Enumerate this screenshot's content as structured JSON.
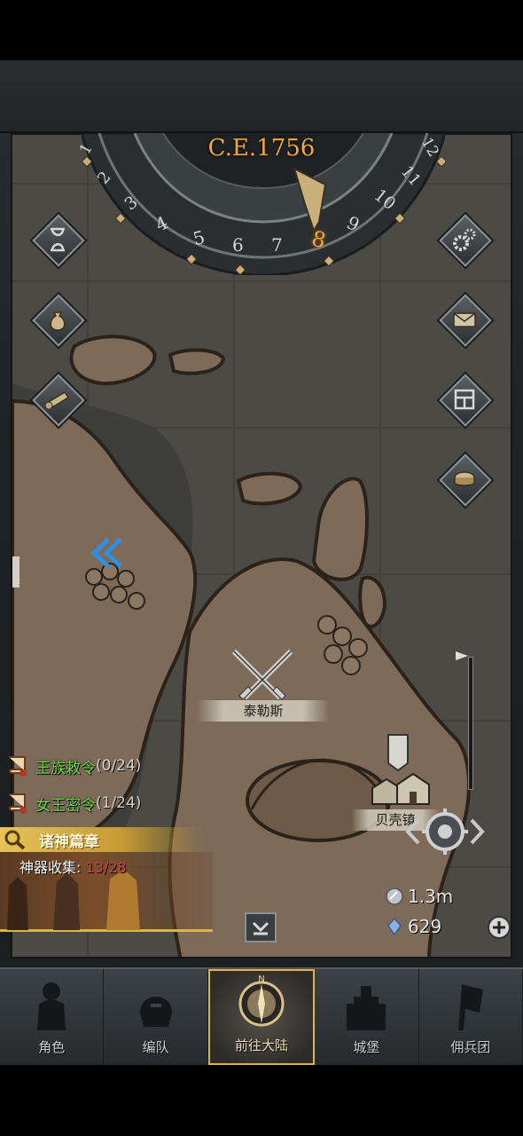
{
  "calendar": {
    "year_label": "C.E.1756",
    "months": [
      "1",
      "2",
      "3",
      "4",
      "5",
      "6",
      "7",
      "8",
      "9",
      "10",
      "11",
      "12"
    ],
    "current_month": "8"
  },
  "left_buttons": [
    {
      "icon": "hourglass-icon"
    },
    {
      "icon": "money-bag-icon"
    },
    {
      "icon": "scroll-icon"
    }
  ],
  "right_buttons": [
    {
      "icon": "gear-icon"
    },
    {
      "icon": "mail-icon"
    },
    {
      "icon": "window-grid-icon"
    },
    {
      "icon": "drum-icon"
    }
  ],
  "map": {
    "locations": [
      {
        "name": "泰勒斯"
      },
      {
        "name": "贝壳镇"
      }
    ]
  },
  "quests": [
    {
      "name": "王族敕令",
      "progress": "(0/24)"
    },
    {
      "name": "女王密令",
      "progress": "(1/24)"
    }
  ],
  "gods_chapter": {
    "title": "诸神篇章",
    "collect_label": "神器收集: ",
    "collect_value": "13/28"
  },
  "resources": {
    "silver": "1.3m",
    "crystal": "629"
  },
  "nav": [
    {
      "label": "角色",
      "icon": "knight-icon",
      "active": false
    },
    {
      "label": "编队",
      "icon": "helmet-icon",
      "active": false
    },
    {
      "label": "前往大陆",
      "icon": "compass-icon",
      "active": true
    },
    {
      "label": "城堡",
      "icon": "castle-icon",
      "active": false
    },
    {
      "label": "佣兵团",
      "icon": "banner-icon",
      "active": false
    }
  ],
  "compass_north": "N",
  "colors": {
    "accent_gold": "#f2a83a",
    "quest_green": "#6fdc4a",
    "collect_red": "#c9484a"
  }
}
